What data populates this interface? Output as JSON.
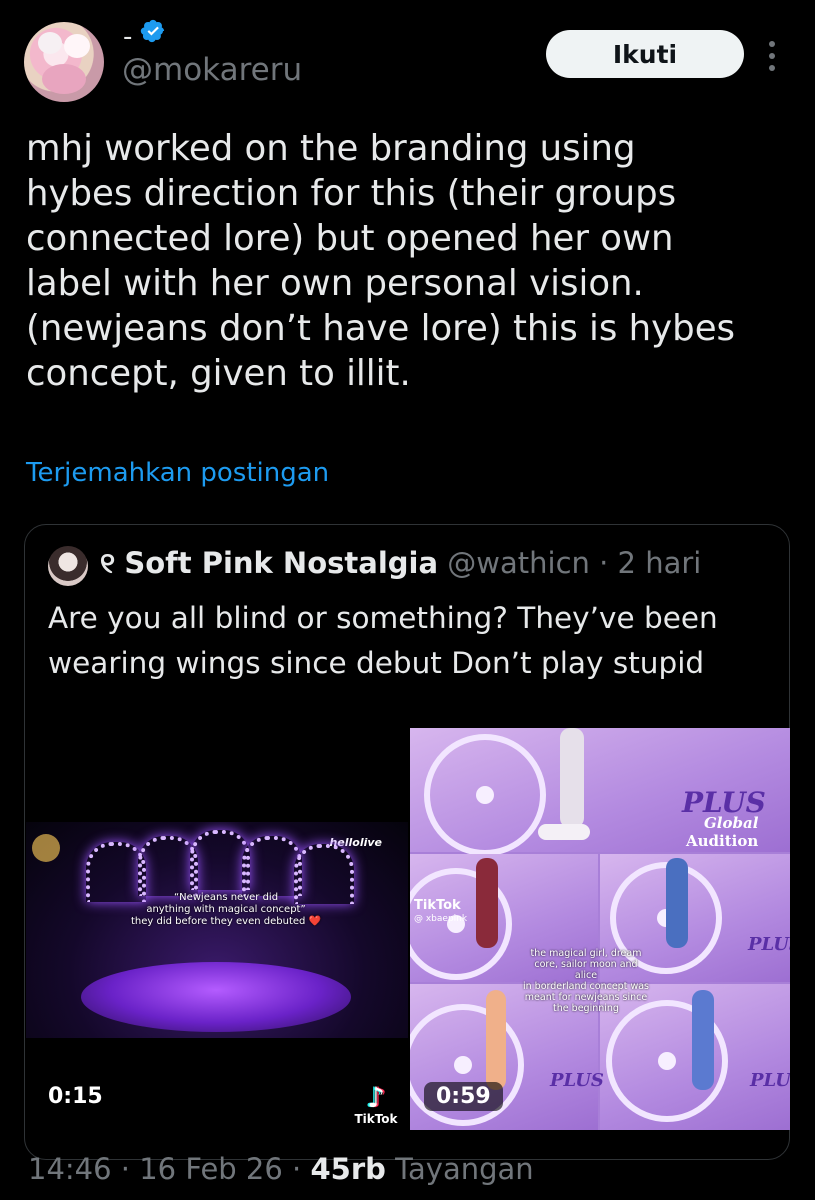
{
  "author": {
    "display_name": "-",
    "username": "@mokareru",
    "verified_icon": "verified-badge-icon",
    "follow_label": "Ikuti"
  },
  "tweet": {
    "lines": [
      "mhj worked on the branding using",
      "hybes direction for this (their groups",
      "connected lore) but opened her own",
      "label with her own personal vision.",
      "(newjeans don’t have lore) this is hybes",
      "concept, given to illit."
    ],
    "translate_label": "Terjemahkan postingan"
  },
  "quote": {
    "badge": "୧",
    "name": "Soft Pink Nostalgia",
    "handle": "@wathicn",
    "separator": "·",
    "time": "2 hari",
    "lines": [
      "Are you all blind or something? They’ve been",
      "wearing wings since debut Don’t play stupid"
    ]
  },
  "media": {
    "left": {
      "duration": "0:15",
      "overlay_text_lines": [
        "“Newjeans never did",
        "anything with magical concept”",
        "they did before they even debuted ❤️"
      ],
      "brand": "hellolive"
    },
    "right": {
      "duration": "0:59",
      "overlay_text_lines": [
        "the magical girl, dream",
        "core, sailor moon and alice",
        "in borderland concept was",
        "meant for newjeans since",
        "the beginning"
      ],
      "plus_top": "PLUS",
      "global": "Global",
      "audition": "Audition",
      "plus_small": "PLUS",
      "tiktok_watermark": "TikTok",
      "tiktok_handle": "@ xbaepink"
    },
    "tiktok_logo_label": "TikTok"
  },
  "footer": {
    "time": "14:46",
    "date": "16 Feb 26",
    "separator": "·",
    "views_count": "45rb",
    "views_label": "Tayangan"
  }
}
